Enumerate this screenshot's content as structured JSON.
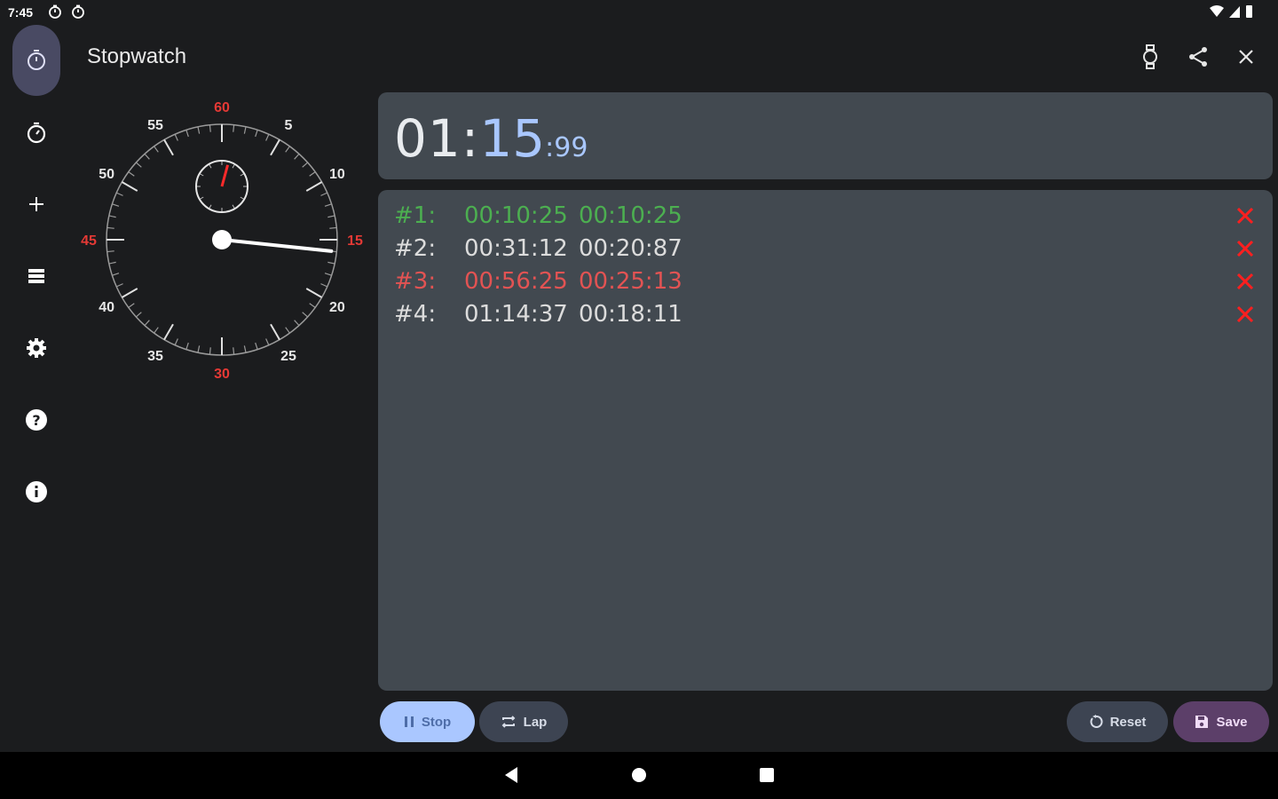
{
  "status_bar": {
    "time": "7:45"
  },
  "app": {
    "title": "Stopwatch"
  },
  "nav_rail": {
    "items": [
      {
        "icon": "stopwatch-icon",
        "active": true
      },
      {
        "icon": "timer-icon"
      },
      {
        "icon": "add-icon"
      },
      {
        "icon": "list-icon"
      },
      {
        "icon": "settings-icon"
      },
      {
        "icon": "help-icon"
      },
      {
        "icon": "info-icon"
      }
    ]
  },
  "top_actions": [
    "watch-icon",
    "share-icon",
    "close-icon"
  ],
  "dial": {
    "labels": [
      "60",
      "5",
      "10",
      "15",
      "20",
      "25",
      "30",
      "35",
      "40",
      "45",
      "50",
      "55"
    ],
    "accent_labels": [
      "60",
      "15",
      "30",
      "45"
    ],
    "seconds_hand": 15.99,
    "minutes_hand": 1.27
  },
  "timer": {
    "main": "01:",
    "seconds": "15",
    "hundredths": ":99"
  },
  "laps": [
    {
      "num": "#1:",
      "total": "00:10:25",
      "split": "00:10:25",
      "color": "#4caf50"
    },
    {
      "num": "#2:",
      "total": "00:31:12",
      "split": "00:20:87",
      "color": "#dcdcdc"
    },
    {
      "num": "#3:",
      "total": "00:56:25",
      "split": "00:25:13",
      "color": "#e25353"
    },
    {
      "num": "#4:",
      "total": "01:14:37",
      "split": "00:18:11",
      "color": "#dcdcdc"
    }
  ],
  "buttons": {
    "stop": "Stop",
    "lap": "Lap",
    "reset": "Reset",
    "save": "Save"
  },
  "colors": {
    "accent": "#aac7ff",
    "delete": "#ff1f1f",
    "fastest": "#4caf50",
    "slowest": "#e25353"
  }
}
